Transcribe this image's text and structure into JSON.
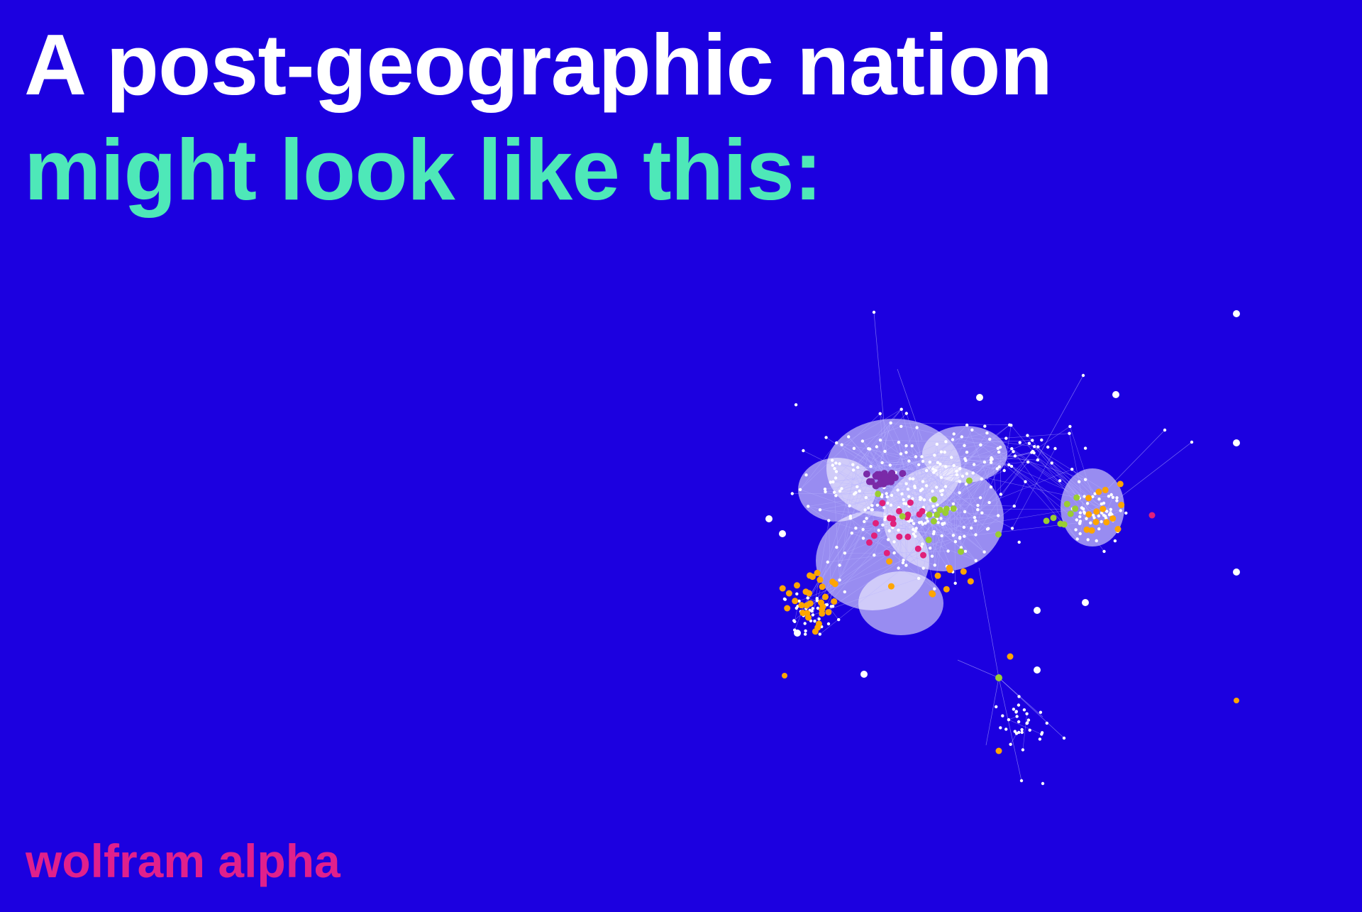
{
  "headline": {
    "line1": "A post-geographic nation",
    "line2": "might look like this:"
  },
  "brand": "wolfram alpha",
  "colors": {
    "background": "#1c00e0",
    "headline_primary": "#ffffff",
    "headline_accent": "#4ee8b8",
    "brand": "#e0208c",
    "node_default": "#ffffff",
    "node_orange": "#ffa500",
    "node_green": "#9acd32",
    "node_magenta": "#e0207a",
    "node_purple": "#7a2aa8",
    "edge": "#b8b4ff"
  }
}
